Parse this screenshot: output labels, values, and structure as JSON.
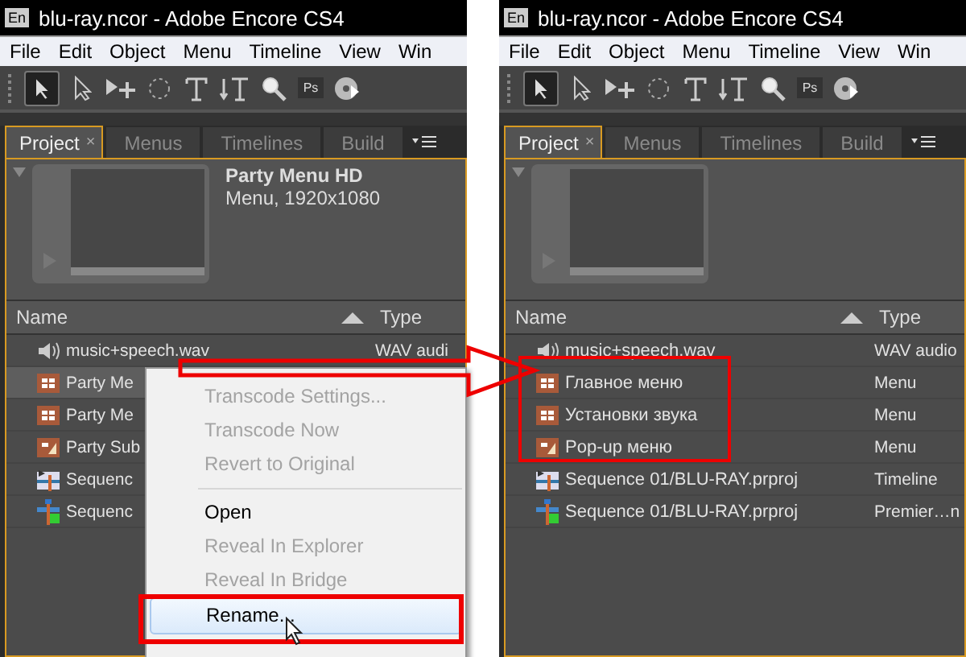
{
  "windows": [
    {
      "badge": "En",
      "title": "blu-ray.ncor - Adobe Encore CS4",
      "menu": [
        "File",
        "Edit",
        "Object",
        "Menu",
        "Timeline",
        "View",
        "Win"
      ],
      "tools": [
        {
          "kind": "select",
          "selected": true
        },
        {
          "kind": "direct",
          "selected": false
        },
        {
          "kind": "move",
          "selected": false
        },
        {
          "kind": "rotate",
          "selected": false
        },
        {
          "kind": "text",
          "selected": false
        },
        {
          "kind": "vtext",
          "selected": false
        },
        {
          "kind": "zoom",
          "selected": false
        },
        {
          "kind": "ps",
          "label": "Ps",
          "selected": false
        },
        {
          "kind": "disc",
          "selected": false
        }
      ],
      "tabs": [
        {
          "label": "Project",
          "close": "×",
          "selected": true
        },
        {
          "label": "Menus",
          "selected": false
        },
        {
          "label": "Timelines",
          "selected": false
        },
        {
          "label": "Build",
          "selected": false
        }
      ],
      "preview": {
        "title": "Party Menu HD",
        "subtitle": "Menu, 1920x1080"
      },
      "columns": [
        "Name",
        "Type"
      ],
      "rows": [
        {
          "kind": "audio",
          "name": "music+speech.wav",
          "type": "WAV audi",
          "selected": false
        },
        {
          "kind": "menu",
          "name": "Party Me",
          "selected": true
        },
        {
          "kind": "menu",
          "name": "Party Me",
          "selected": false
        },
        {
          "kind": "submenu",
          "name": "Party Sub",
          "selected": false
        },
        {
          "kind": "timeline",
          "name": "Sequenc",
          "selected": false
        },
        {
          "kind": "premiere",
          "name": "Sequenc",
          "selected": false
        }
      ]
    },
    {
      "badge": "En",
      "title": "blu-ray.ncor - Adobe Encore CS4",
      "menu": [
        "File",
        "Edit",
        "Object",
        "Menu",
        "Timeline",
        "View",
        "Win"
      ],
      "tools": [
        {
          "kind": "select",
          "selected": true
        },
        {
          "kind": "direct",
          "selected": false
        },
        {
          "kind": "move",
          "selected": false
        },
        {
          "kind": "rotate",
          "selected": false
        },
        {
          "kind": "text",
          "selected": false
        },
        {
          "kind": "vtext",
          "selected": false
        },
        {
          "kind": "zoom",
          "selected": false
        },
        {
          "kind": "ps",
          "label": "Ps",
          "selected": false
        },
        {
          "kind": "disc",
          "selected": false
        }
      ],
      "tabs": [
        {
          "label": "Project",
          "close": "×",
          "selected": true
        },
        {
          "label": "Menus",
          "selected": false
        },
        {
          "label": "Timelines",
          "selected": false
        },
        {
          "label": "Build",
          "selected": false
        }
      ],
      "columns": [
        "Name",
        "Type"
      ],
      "rows": [
        {
          "kind": "audio",
          "name": "music+speech.wav",
          "type": "WAV audio",
          "selected": false
        },
        {
          "kind": "menu",
          "name": "Главное меню",
          "type": "Menu",
          "selected": false
        },
        {
          "kind": "menu",
          "name": "Установки звука",
          "type": "Menu",
          "selected": false
        },
        {
          "kind": "submenu",
          "name": "Pop-up меню",
          "type": "Menu",
          "selected": false
        },
        {
          "kind": "timeline",
          "name": "Sequence 01/BLU-RAY.prproj",
          "type": "Timeline",
          "selected": false
        },
        {
          "kind": "premiere",
          "name": "Sequence 01/BLU-RAY.prproj",
          "type": "Premier…n",
          "selected": false
        }
      ]
    }
  ],
  "context_menu": [
    {
      "kind": "item",
      "label": "Transcode Settings...",
      "disabled": true,
      "selected": false
    },
    {
      "kind": "item",
      "label": "Transcode Now",
      "disabled": true,
      "selected": false
    },
    {
      "kind": "item",
      "label": "Revert to Original",
      "disabled": true,
      "selected": false
    },
    {
      "kind": "separator"
    },
    {
      "kind": "item",
      "label": "Open",
      "disabled": false,
      "selected": false
    },
    {
      "kind": "item",
      "label": "Reveal In Explorer",
      "disabled": true,
      "selected": false
    },
    {
      "kind": "item",
      "label": "Reveal In Bridge",
      "disabled": true,
      "selected": false
    },
    {
      "kind": "item",
      "label": "Rename...",
      "disabled": false,
      "selected": true
    }
  ]
}
